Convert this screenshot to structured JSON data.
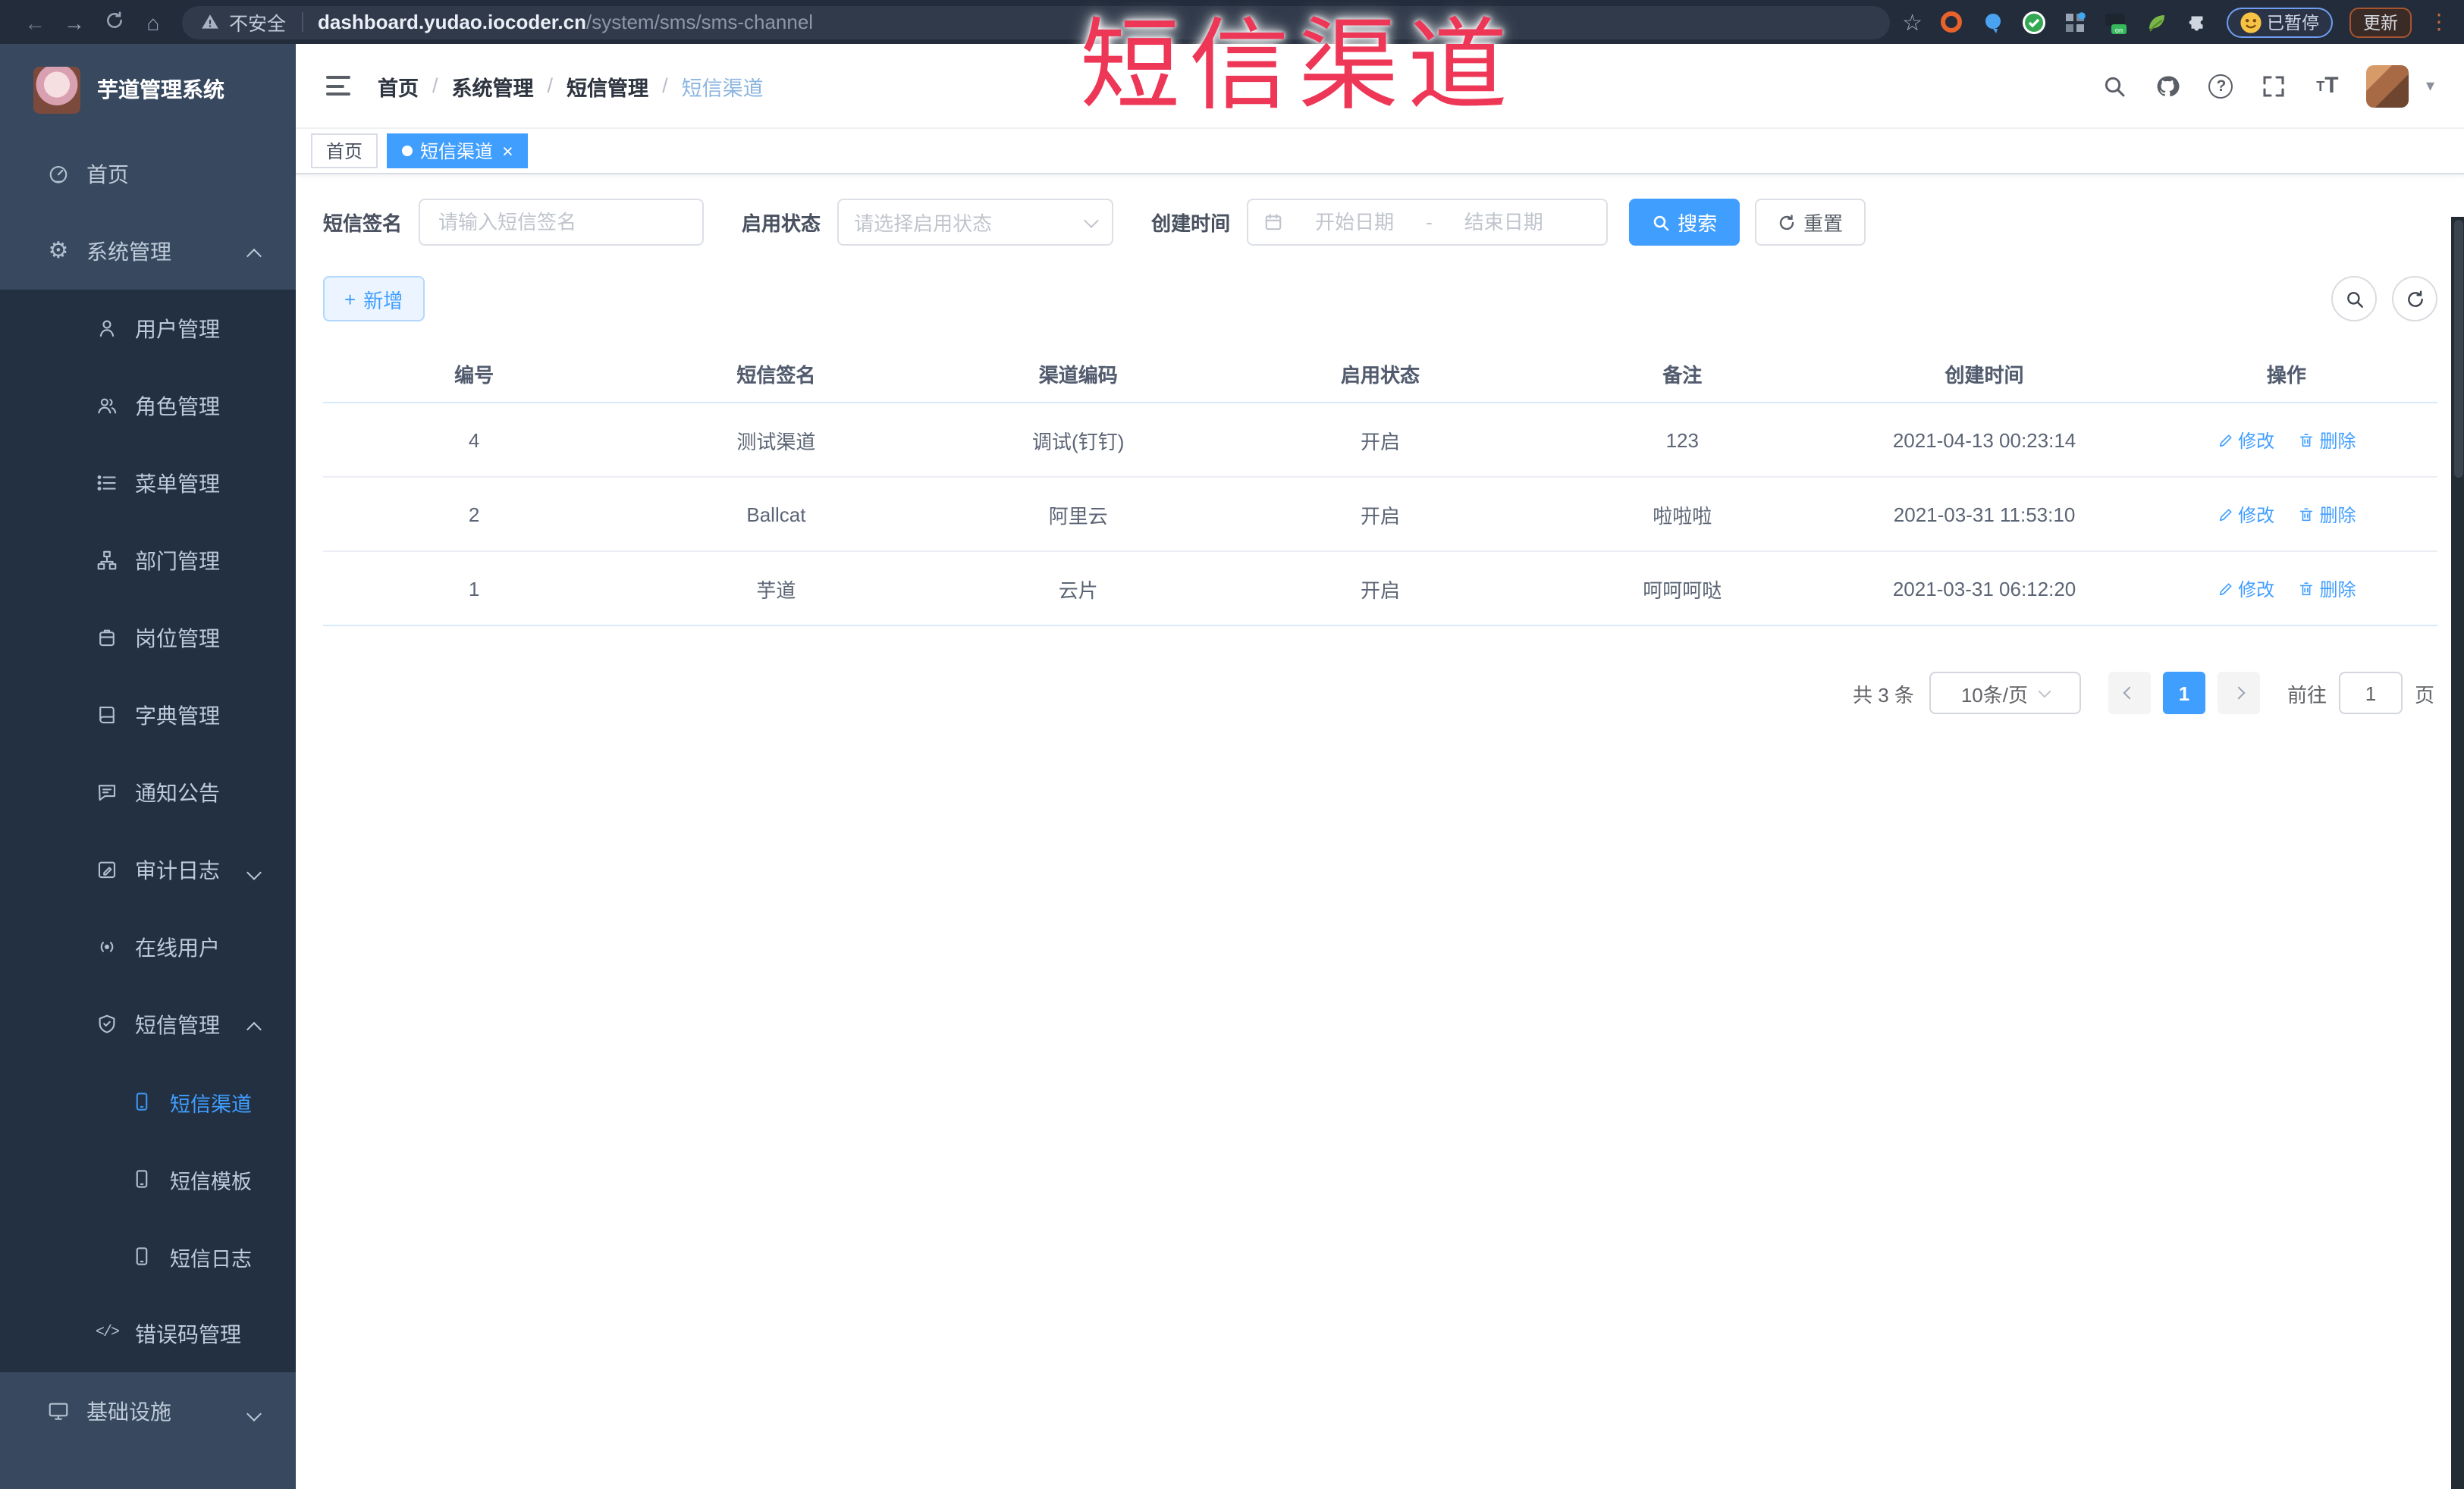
{
  "browser": {
    "security_label": "不安全",
    "url_host": "dashboard.yudao.iocoder.cn",
    "url_path": "/system/sms/sms-channel",
    "paused_badge": "已暂停",
    "update_button": "更新"
  },
  "overlay_title": "短信渠道",
  "sidebar": {
    "app_title": "芋道管理系统",
    "menu": [
      {
        "label": "首页"
      },
      {
        "label": "系统管理"
      },
      {
        "label": "用户管理"
      },
      {
        "label": "角色管理"
      },
      {
        "label": "菜单管理"
      },
      {
        "label": "部门管理"
      },
      {
        "label": "岗位管理"
      },
      {
        "label": "字典管理"
      },
      {
        "label": "通知公告"
      },
      {
        "label": "审计日志"
      },
      {
        "label": "在线用户"
      },
      {
        "label": "短信管理"
      },
      {
        "label": "短信渠道"
      },
      {
        "label": "短信模板"
      },
      {
        "label": "短信日志"
      },
      {
        "label": "错误码管理"
      },
      {
        "label": "基础设施"
      }
    ]
  },
  "header": {
    "breadcrumb": [
      "首页",
      "系统管理",
      "短信管理",
      "短信渠道"
    ]
  },
  "tabs": [
    {
      "label": "首页"
    },
    {
      "label": "短信渠道"
    }
  ],
  "filters": {
    "sign_label": "短信签名",
    "sign_placeholder": "请输入短信签名",
    "status_label": "启用状态",
    "status_placeholder": "请选择启用状态",
    "time_label": "创建时间",
    "start_placeholder": "开始日期",
    "range_separator": "-",
    "end_placeholder": "结束日期",
    "search_label": "搜索",
    "reset_label": "重置"
  },
  "toolbar": {
    "add_label": "新增"
  },
  "table": {
    "headers": [
      "编号",
      "短信签名",
      "渠道编码",
      "启用状态",
      "备注",
      "创建时间",
      "操作"
    ],
    "edit_label": "修改",
    "delete_label": "删除",
    "rows": [
      {
        "id": "4",
        "sign": "测试渠道",
        "code": "调试(钉钉)",
        "status": "开启",
        "remark": "123",
        "created": "2021-04-13 00:23:14"
      },
      {
        "id": "2",
        "sign": "Ballcat",
        "code": "阿里云",
        "status": "开启",
        "remark": "啦啦啦",
        "created": "2021-03-31 11:53:10"
      },
      {
        "id": "1",
        "sign": "芋道",
        "code": "云片",
        "status": "开启",
        "remark": "呵呵呵哒",
        "created": "2021-03-31 06:12:20"
      }
    ]
  },
  "pagination": {
    "total": "共 3 条",
    "page_size": "10条/页",
    "current_page": "1",
    "goto_label": "前往",
    "goto_value": "1",
    "unit_label": "页"
  },
  "colors": {
    "accent": "#409EFF",
    "sidebar": "#38485f",
    "submenu": "#223042",
    "overlay": "#ee3757"
  }
}
